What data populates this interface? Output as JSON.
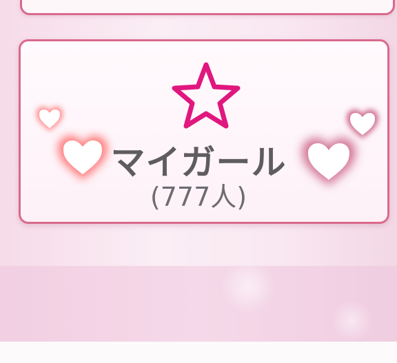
{
  "card": {
    "title": "マイガール",
    "count": "(777人)"
  },
  "icons": {
    "main": "star-outline-icon",
    "decor": "heart-icon"
  },
  "colors": {
    "star": "#e0177f",
    "border": "#d9698c",
    "heart_left_glow": "#ff6b6b",
    "heart_right_glow": "#c8567e",
    "title_text": "#5f5c60"
  }
}
